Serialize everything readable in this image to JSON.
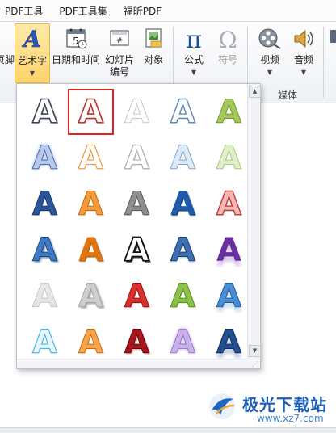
{
  "menu": [
    "PDF工具",
    "PDF工具集",
    "福昕PDF"
  ],
  "ribbon": {
    "footer_label_partial": "页脚",
    "wordart_label": "艺术字",
    "datetime_label": "日期和时间",
    "slide_number_label_1": "幻灯片",
    "slide_number_label_2": "编号",
    "object_label": "对象",
    "formula_label": "公式",
    "symbol_label": "符号",
    "video_label": "视频",
    "audio_label": "音频",
    "media_group_label": "媒体",
    "calendar_number": "5"
  },
  "colors": {
    "selection_outline": "#e02424",
    "active_button": "#ffd36b",
    "watermark_blue": "#1e5fb8"
  },
  "gallery": {
    "glyph": "A",
    "selected_index": 1,
    "rows": [
      [
        "outline-dark-gray",
        "outline-red",
        "outline-light-gray",
        "outline-blue",
        "outline-green"
      ],
      [
        "blue-glow",
        "orange-outline",
        "gray-outline",
        "light-blue",
        "light-green"
      ],
      [
        "blue-gradient",
        "orange-gradient",
        "silver-gradient",
        "blue-bevel",
        "red-outline"
      ],
      [
        "blue-shadow",
        "orange-solid",
        "black-outline",
        "blue-metal",
        "purple-reflection"
      ],
      [
        "light-gray",
        "silver-shadow",
        "red-gradient",
        "green-gradient",
        "blue-reflection"
      ],
      [
        "cyan-outline",
        "orange-bevel",
        "dark-red",
        "lavender-glow",
        "navy-reflection"
      ]
    ]
  },
  "watermark": {
    "text": "极光下载站",
    "url": "www.xz7.com"
  }
}
